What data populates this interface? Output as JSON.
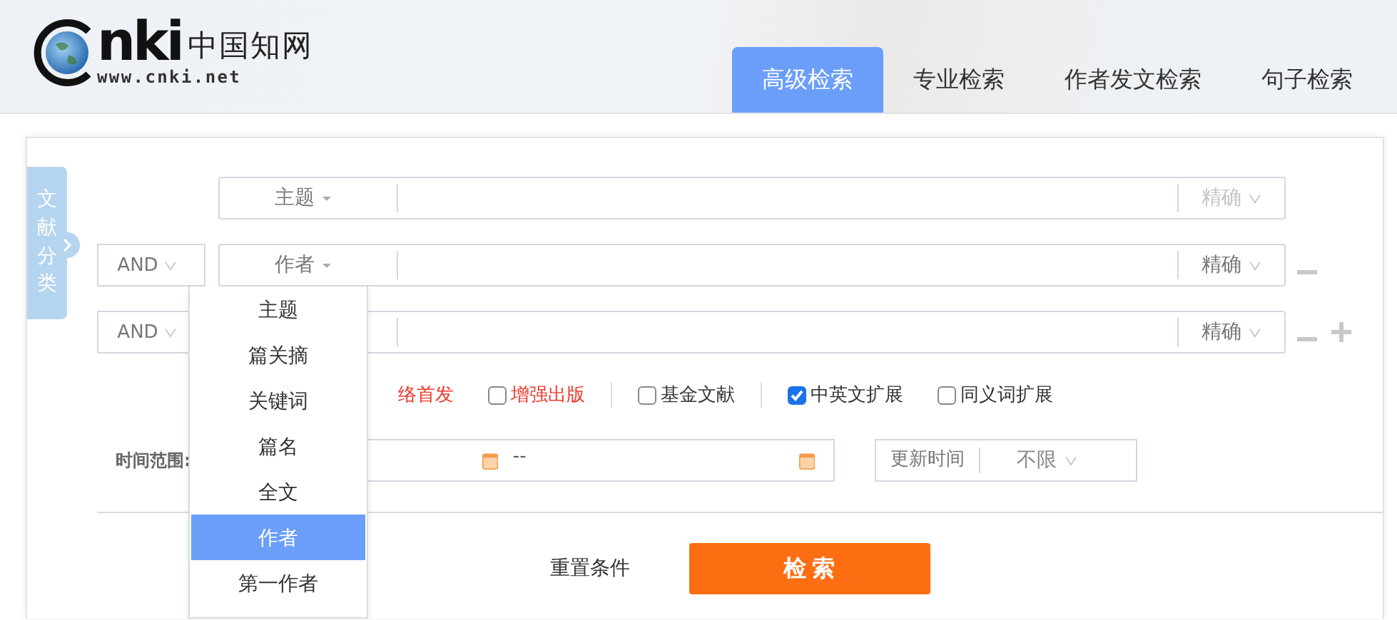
{
  "header": {
    "logo": {
      "mark": "nki",
      "chinese": "中国知网",
      "url": "www.cnki.net"
    },
    "tabs": [
      {
        "label": "高级检索",
        "selected": true
      },
      {
        "label": "专业检索",
        "selected": false
      },
      {
        "label": "作者发文检索",
        "selected": false
      },
      {
        "label": "句子检索",
        "selected": false
      }
    ]
  },
  "side_tab": {
    "label": "文献分类"
  },
  "query_rows": [
    {
      "field": "主题",
      "match": "精确",
      "match_disabled": true,
      "can_remove": false,
      "can_add": false
    },
    {
      "logic": "AND",
      "field": "作者",
      "match": "精确",
      "match_disabled": false,
      "can_remove": true,
      "can_add": false
    },
    {
      "logic": "AND",
      "match": "精确",
      "match_disabled": false,
      "can_remove": true,
      "can_add": true
    }
  ],
  "field_dropdown": {
    "items": [
      {
        "label": "主题",
        "selected": false
      },
      {
        "label": "篇关摘",
        "selected": false
      },
      {
        "label": "关键词",
        "selected": false
      },
      {
        "label": "篇名",
        "selected": false
      },
      {
        "label": "全文",
        "selected": false
      },
      {
        "label": "作者",
        "selected": true
      },
      {
        "label": "第一作者",
        "selected": false
      }
    ]
  },
  "option_groups": [
    [
      {
        "kind": "partial",
        "label": "络首发",
        "highlight": true
      },
      {
        "kind": "checkbox",
        "label": "增强出版",
        "checked": false,
        "highlight": true
      }
    ],
    [
      {
        "kind": "checkbox",
        "label": "基金文献",
        "checked": false,
        "highlight": false
      }
    ],
    [
      {
        "kind": "checkbox",
        "label": "中英文扩展",
        "checked": true,
        "highlight": false
      },
      {
        "kind": "checkbox",
        "label": "同义词扩展",
        "checked": false,
        "highlight": false
      }
    ]
  ],
  "time_range": {
    "label": "时间范围:",
    "separator": "--"
  },
  "update_time": {
    "label": "更新时间",
    "value": "不限"
  },
  "actions": {
    "reset": "重置条件",
    "search": "检 索"
  }
}
